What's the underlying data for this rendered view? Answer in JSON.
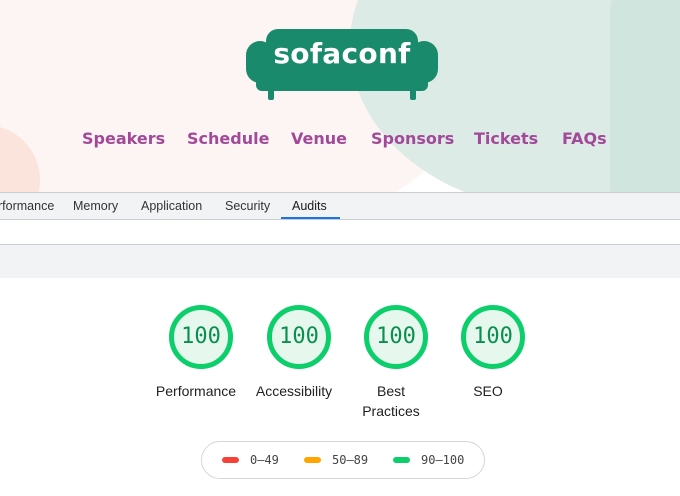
{
  "site": {
    "logo_text": "sofaconf",
    "nav": [
      "Speakers",
      "Schedule",
      "Venue",
      "Sponsors",
      "Tickets",
      "FAQs"
    ]
  },
  "devtools": {
    "tabs": [
      "rformance",
      "Memory",
      "Application",
      "Security",
      "Audits"
    ],
    "active_tab": "Audits"
  },
  "report": {
    "gauges": [
      {
        "score": "100",
        "label": "Performance"
      },
      {
        "score": "100",
        "label": "Accessibility"
      },
      {
        "score": "100",
        "label": "Best Practices"
      },
      {
        "score": "100",
        "label": "SEO"
      }
    ],
    "legend": [
      {
        "range": "0–49",
        "color": "#f44336"
      },
      {
        "range": "50–89",
        "color": "#ffa400"
      },
      {
        "range": "90–100",
        "color": "#0cce6b"
      }
    ]
  },
  "colors": {
    "brand_green": "#1a8a6c",
    "nav_purple": "#a24a99",
    "pass_green": "#0cce6b",
    "devtools_accent": "#1a73e8"
  }
}
